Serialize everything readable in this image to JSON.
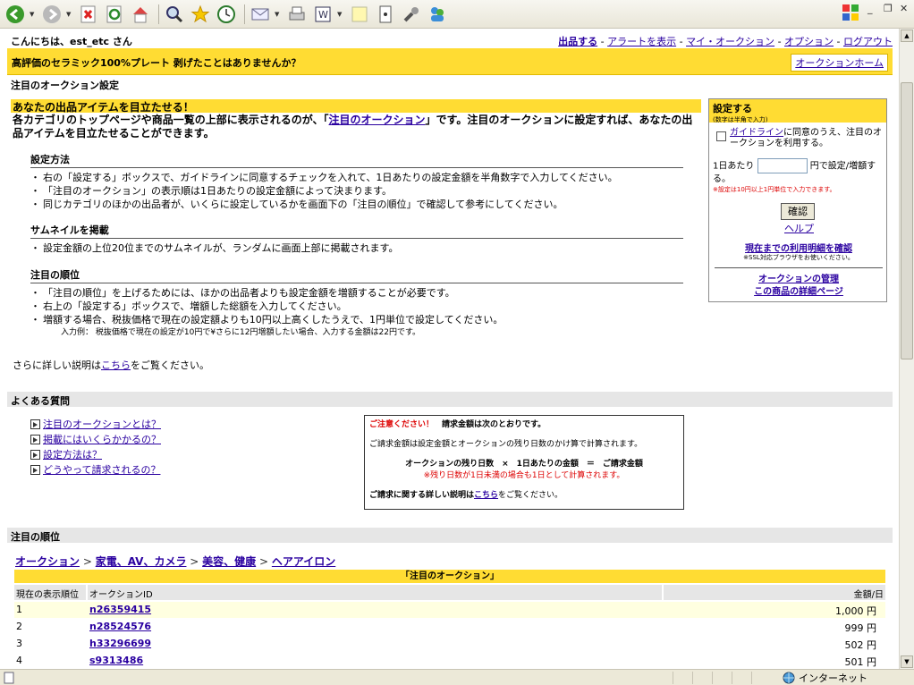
{
  "browser": {
    "status_zone": "インターネット"
  },
  "header": {
    "greeting": "こんにちは、est_etc さん",
    "links": [
      "出品する",
      "アラートを表示",
      "マイ・オークション",
      "オプション",
      "ログアウト"
    ],
    "promo": "高評価のセラミック100%プレート 剥げたことはありませんか？",
    "auction_home": "オークションホーム"
  },
  "page_title": "注目のオークション設定",
  "intro": {
    "heading": "あなたの出品アイテムを目立たせる！",
    "text_before": "各カテゴリのトップページや商品一覧の上部に表示されるのが、「",
    "link": "注目のオークション",
    "text_after": "」です。注目のオークションに設定すれば、あなたの出品アイテムを目立たせることができます。"
  },
  "sections": {
    "howto": {
      "title": "設定方法",
      "items": [
        "右の「設定する」ボックスで、ガイドラインに同意するチェックを入れて、1日あたりの設定金額を半角数字で入力してください。",
        "「注目のオークション」の表示順は1日あたりの設定金額によって決まります。",
        "同じカテゴリのほかの出品者が、いくらに設定しているかを画面下の「注目の順位」で確認して参考にしてください。"
      ]
    },
    "thumbnail": {
      "title": "サムネイルを掲載",
      "items": [
        "設定金額の上位20位までのサムネイルが、ランダムに画面上部に掲載されます。"
      ]
    },
    "ranking": {
      "title": "注目の順位",
      "items": [
        "「注目の順位」を上げるためには、ほかの出品者よりも設定金額を増額することが必要です。",
        "右上の「設定する」ボックスで、増額した総額を入力してください。",
        "増額する場合、税抜価格で現在の設定額よりも10円以上高くしたうえで、1円単位で設定してください。"
      ],
      "note": "入力例： 税抜価格で現在の設定が10円で¥さらに12円増額したい場合、入力する金額は22円です。"
    }
  },
  "more": {
    "before": "さらに詳しい説明は",
    "link": "こちら",
    "after": "をご覧ください。"
  },
  "setbox": {
    "title": "設定する",
    "subtitle": "(数字は半角で入力)",
    "agree_link": "ガイドライン",
    "agree_text": "に同意のうえ、注目のオークションを利用する。",
    "amount_prefix": "1日あたり",
    "amount_value": "",
    "amount_suffix": "円で設定/増額する。",
    "warning": "※設定は10円以上1円単位で入力できます。",
    "confirm": "確認",
    "help": "ヘルプ",
    "statement": "現在までの利用明細を確認",
    "ssl": "※SSL対応ブラウザをお使いください。",
    "manage": "オークションの管理",
    "item_detail": "この商品の詳細ページ"
  },
  "faq": {
    "title": "よくある質問",
    "items": [
      "注目のオークションとは？",
      "掲載にはいくらかかるの？",
      "設定方法は？",
      "どうやって請求されるの？"
    ]
  },
  "notice": {
    "attention": "ご注意ください！",
    "heading": "請求金額は次のとおりです。",
    "line1": "ご請求金額は設定金額とオークションの残り日数のかけ算で計算されます。",
    "formula": "オークションの残り日数　×　1日あたりの金額　＝　ご請求金額",
    "formula_note": "※残り日数が1日未満の場合も1日として計算されます。",
    "more_before": "ご請求に関する詳しい説明は",
    "more_link": "こちら",
    "more_after": "をご覧ください。"
  },
  "ranking": {
    "title": "注目の順位",
    "breadcrumb": [
      "オークション",
      "家電、AV、カメラ",
      "美容、健康",
      "ヘアアイロン"
    ],
    "table_title": "「注目のオークション」",
    "headers": [
      "現在の表示順位",
      "オークションID",
      "金額/日"
    ],
    "rows": [
      {
        "rank": "1",
        "id": "n26359415",
        "amount": "1,000 円"
      },
      {
        "rank": "2",
        "id": "n28524576",
        "amount": "999 円"
      },
      {
        "rank": "3",
        "id": "h33296699",
        "amount": "502 円"
      },
      {
        "rank": "4",
        "id": "s9313486",
        "amount": "501 円"
      }
    ]
  },
  "colors": {
    "accent_yellow": "#ffdc33",
    "link": "#2a00a0",
    "warning_red": "#dd0000"
  }
}
